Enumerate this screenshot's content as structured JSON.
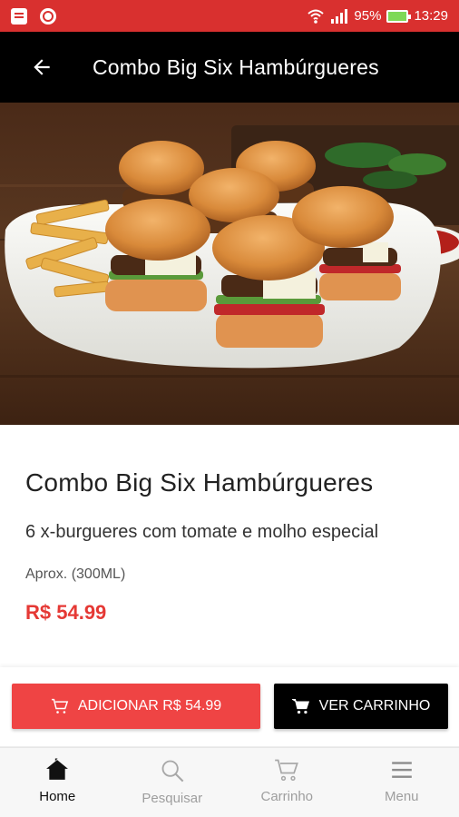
{
  "status_bar": {
    "battery_percent": "95%",
    "time": "13:29"
  },
  "app_bar": {
    "title": "Combo Big Six Hambúrgueres",
    "back_icon": "arrow-left-icon"
  },
  "product": {
    "title": "Combo Big Six Hambúrgueres",
    "description": "6 x-burgueres com tomate e molho especial",
    "size": "Aprox. (300ML)",
    "price": "R$ 54.99"
  },
  "actions": {
    "add_label": "ADICIONAR R$ 54.99",
    "view_cart_label": "VER CARRINHO"
  },
  "bottom_nav": {
    "items": [
      {
        "label": "Home",
        "icon": "home-icon",
        "active": true
      },
      {
        "label": "Pesquisar",
        "icon": "search-icon",
        "active": false
      },
      {
        "label": "Carrinho",
        "icon": "cart-icon",
        "active": false
      },
      {
        "label": "Menu",
        "icon": "menu-icon",
        "active": false
      }
    ]
  },
  "colors": {
    "status_bar": "#d9302f",
    "app_bar": "#000000",
    "accent": "#ef4444",
    "price": "#e53935"
  }
}
